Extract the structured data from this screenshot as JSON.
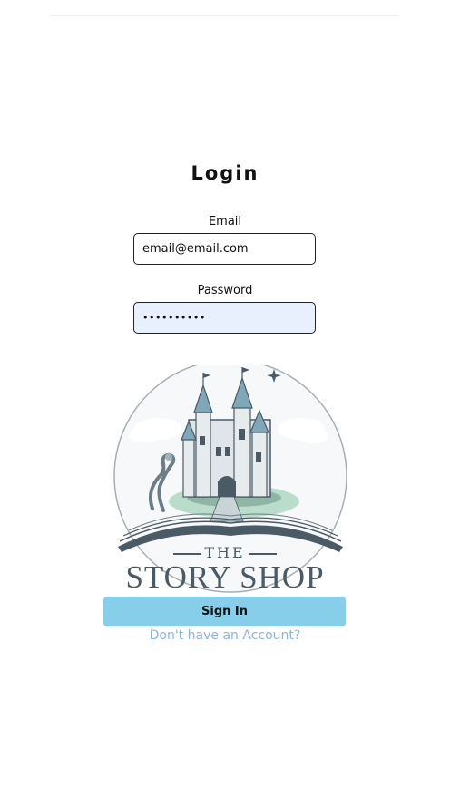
{
  "form": {
    "title": "Login",
    "email_label": "Email",
    "email_value": "email@email.com",
    "password_label": "Password",
    "password_value": "••••••••••",
    "submit_label": "Sign In",
    "signup_link": "Don't have an Account?"
  },
  "logo": {
    "line1": "THE",
    "line2": "STORY SHOP"
  },
  "colors": {
    "button": "#87ceeb",
    "link": "#8ab4e8",
    "autofill": "#e8f0fe",
    "logo": "#4b5b66"
  }
}
